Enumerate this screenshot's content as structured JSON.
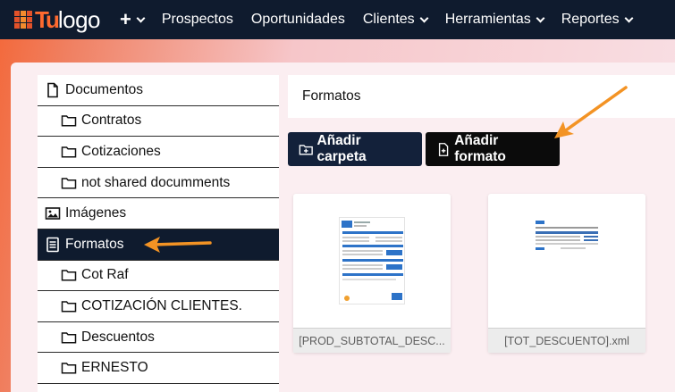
{
  "brand": {
    "tu": "Tu",
    "logo": "logo"
  },
  "nav": {
    "items": [
      {
        "label": "Prospectos",
        "caret": false
      },
      {
        "label": "Oportunidades",
        "caret": false
      },
      {
        "label": "Clientes",
        "caret": true
      },
      {
        "label": "Herramientas",
        "caret": true
      },
      {
        "label": "Reportes",
        "caret": true
      }
    ]
  },
  "sidebar": {
    "items": [
      {
        "label": "Documentos",
        "icon": "document-icon",
        "level": 0,
        "active": false
      },
      {
        "label": "Contratos",
        "icon": "folder-icon",
        "level": 1,
        "active": false
      },
      {
        "label": "Cotizaciones",
        "icon": "folder-icon",
        "level": 1,
        "active": false
      },
      {
        "label": "not shared documments",
        "icon": "folder-icon",
        "level": 1,
        "active": false
      },
      {
        "label": "Imágenes",
        "icon": "image-icon",
        "level": 0,
        "active": false
      },
      {
        "label": "Formatos",
        "icon": "format-icon",
        "level": 0,
        "active": true
      },
      {
        "label": "Cot Raf",
        "icon": "folder-icon",
        "level": 1,
        "active": false
      },
      {
        "label": "COTIZACIÓN CLIENTES.",
        "icon": "folder-icon",
        "level": 1,
        "active": false
      },
      {
        "label": "Descuentos",
        "icon": "folder-icon",
        "level": 1,
        "active": false
      },
      {
        "label": "ERNESTO",
        "icon": "folder-icon",
        "level": 1,
        "active": false
      }
    ]
  },
  "main": {
    "breadcrumb": "Formatos",
    "add_folder_label": "Añadir carpeta",
    "add_format_label": "Añadir formato",
    "files": [
      {
        "name": "[PROD_SUBTOTAL_DESC..."
      },
      {
        "name": "[TOT_DESCUENTO].xml"
      }
    ]
  },
  "colors": {
    "nav_bg": "#0f1b2e",
    "accent_orange": "#f28b2d",
    "active_bg": "#0f1b2e"
  }
}
